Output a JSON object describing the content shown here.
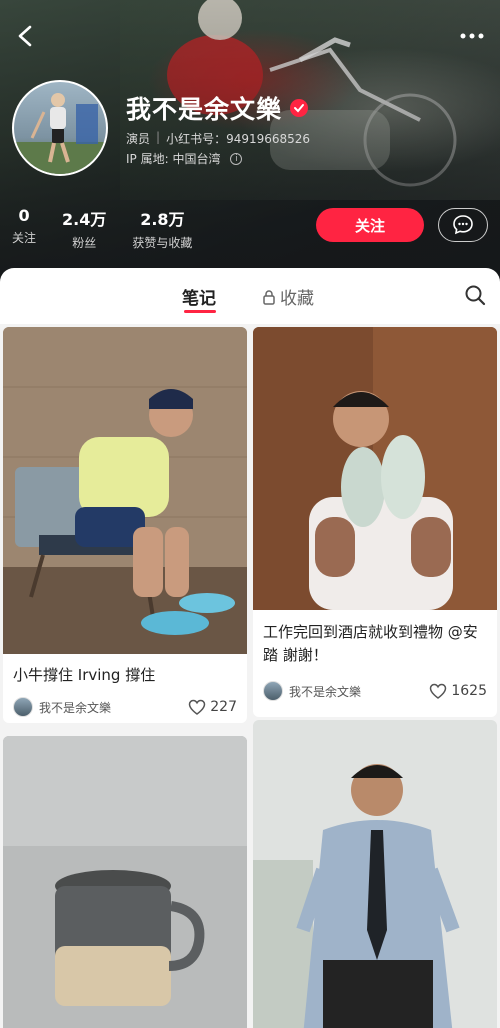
{
  "header": {
    "name": "我不是余文樂",
    "role_label": "演员",
    "id_label": "小红书号：94919668526",
    "ip_label": "IP 属地: 中国台湾",
    "stats": [
      {
        "num": "0",
        "label": "关注"
      },
      {
        "num": "2.4万",
        "label": "粉丝"
      },
      {
        "num": "2.8万",
        "label": "获赞与收藏"
      }
    ],
    "follow_label": "关注",
    "colors": {
      "accent": "#ff2442"
    }
  },
  "tabs": {
    "notes_label": "笔记",
    "collect_label": "收藏"
  },
  "feed": {
    "posts": [
      {
        "title": "小牛撐住 Irving 撐住",
        "author": "我不是余文樂",
        "likes": "227"
      },
      {
        "title": "工作完回到酒店就收到禮物 @安踏 謝謝！",
        "author": "我不是余文樂",
        "likes": "1625"
      }
    ]
  },
  "icons": [
    "back-arrow-icon",
    "more-dots-icon",
    "verified-badge-icon",
    "info-icon",
    "message-icon",
    "lock-icon",
    "search-icon",
    "heart-icon"
  ]
}
